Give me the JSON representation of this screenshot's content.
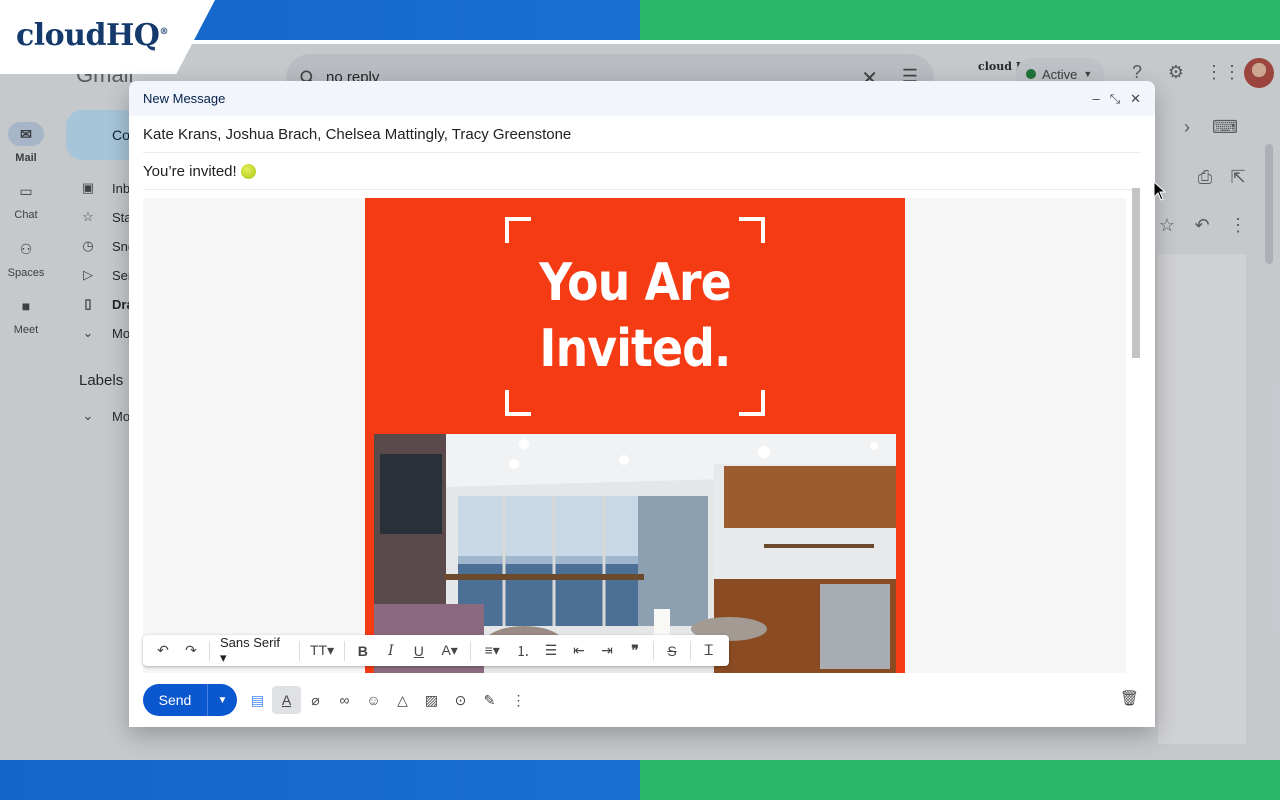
{
  "brand": {
    "name": "cloudHQ",
    "reg": "®"
  },
  "gmail": {
    "logo_text": "Gmail",
    "search": {
      "query": "no reply",
      "clear_icon": "close-icon",
      "tune_icon": "tune-icon"
    },
    "status": "Active",
    "hq_badge": "cloud HQ",
    "rail": [
      {
        "label": "Mail",
        "icon": "mail-icon"
      },
      {
        "label": "Chat",
        "icon": "chat-icon"
      },
      {
        "label": "Spaces",
        "icon": "spaces-icon"
      },
      {
        "label": "Meet",
        "icon": "meet-icon"
      }
    ],
    "compose_label": "Co",
    "nav": [
      "Inb",
      "Sta",
      "Snc",
      "Ser",
      "Dra",
      "Mo"
    ],
    "labels_heading": "Labels",
    "labels_more": "Mo"
  },
  "compose": {
    "title": "New Message",
    "recipients": "Kate Krans, Joshua Brach, Chelsea Mattingly, Tracy Greenstone",
    "subject": "You’re invited!",
    "invite_line1": "You Are",
    "invite_line2": "Invited.",
    "font_name": "Sans Serif",
    "send_label": "Send"
  },
  "colors": {
    "invite_bg": "#f53b14",
    "send_bg": "#0b57d0",
    "brand_blue": "#1565c8",
    "brand_green": "#2bb669"
  }
}
